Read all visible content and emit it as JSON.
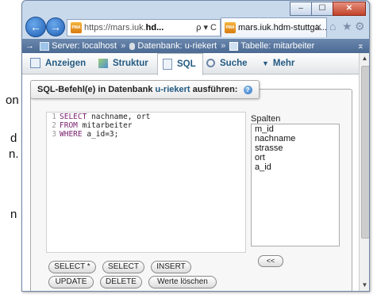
{
  "background_fragments": [
    "on",
    "d",
    "n.",
    "n"
  ],
  "window": {
    "controls": {
      "minimize": "‒",
      "maximize": "☐",
      "close": "✕"
    }
  },
  "nav": {
    "back_icon": "back-arrow-icon",
    "forward_icon": "forward-arrow-icon",
    "address": {
      "prefix": "https://mars.iuk.",
      "highlight": "hd...",
      "actions": "ρ ▾ C"
    },
    "tab_title": "mars.iuk.hdm-stuttga...",
    "tab_close": "✕",
    "right_icons": [
      "⌂",
      "★",
      "⚙"
    ]
  },
  "breadcrumb": {
    "arrow": "→",
    "server": "Server: localhost",
    "sep": "»",
    "database": "Datenbank: u-riekert",
    "table": "Tabelle: mitarbeiter",
    "collapse": "⌅"
  },
  "tabs": [
    {
      "label": "Anzeigen",
      "icon": "table-icon"
    },
    {
      "label": "Struktur",
      "icon": "structure-icon"
    },
    {
      "label": "SQL",
      "icon": "sql-icon"
    },
    {
      "label": "Suche",
      "icon": "search-icon"
    },
    {
      "label": "Mehr",
      "icon": "chevron-down-icon"
    }
  ],
  "sql_panel": {
    "legend_prefix": "SQL-Befehl(e) in Datenbank",
    "legend_db": "u-riekert",
    "legend_suffix": "ausführen:",
    "help_icon": "?",
    "lines": [
      {
        "n": "1",
        "kw": "SELECT",
        "rest": " nachname, ort"
      },
      {
        "n": "2",
        "kw": "FROM",
        "rest": " mitarbeiter"
      },
      {
        "n": "3",
        "kw": "WHERE",
        "rest": " a_id=3;"
      }
    ],
    "columns_label": "Spalten",
    "columns": [
      "m_id",
      "nachname",
      "strasse",
      "ort",
      "a_id"
    ],
    "insert_arrow": "<<",
    "buttons": [
      "SELECT *",
      "SELECT",
      "INSERT",
      "UPDATE",
      "DELETE",
      "Werte löschen"
    ]
  },
  "colors": {
    "pma_blue": "#235a81",
    "keyword": "#7a1f6e"
  }
}
